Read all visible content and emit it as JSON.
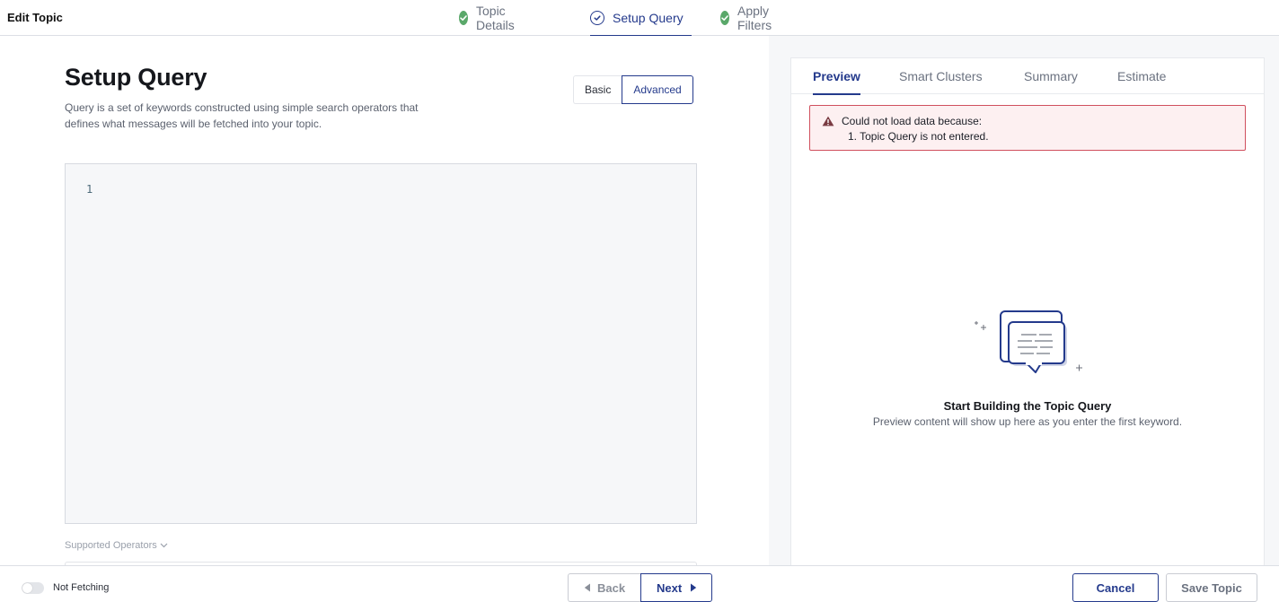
{
  "header": {
    "title": "Edit Topic",
    "steps": [
      {
        "label": "Topic Details",
        "state": "done"
      },
      {
        "label": "Setup Query",
        "state": "active"
      },
      {
        "label": "Apply Filters",
        "state": "done"
      }
    ]
  },
  "query": {
    "title": "Setup Query",
    "description": "Query is a set of keywords constructed using simple search operators that defines what messages will be fetched into your topic.",
    "mode_basic": "Basic",
    "mode_advanced": "Advanced",
    "selected_mode": "Advanced",
    "line_number": "1",
    "supported_operators_label": "Supported Operators"
  },
  "preview": {
    "tabs": [
      "Preview",
      "Smart Clusters",
      "Summary",
      "Estimate"
    ],
    "active_tab": "Preview",
    "error_title": "Could not load data because:",
    "error_item": "1. Topic Query is not entered.",
    "empty_title": "Start Building the Topic Query",
    "empty_desc": "Preview content will show up here as you enter the first keyword."
  },
  "footer": {
    "fetch_status": "Not Fetching",
    "back_label": "Back",
    "next_label": "Next",
    "cancel_label": "Cancel",
    "save_label": "Save Topic"
  },
  "colors": {
    "accent": "#243a8c",
    "success": "#5aa86a",
    "error_border": "#d0505e",
    "error_bg": "#fdf0f1"
  },
  "icons": {
    "step_done": "check-circle-icon",
    "step_active": "check-circle-outline-icon",
    "error": "warning-triangle-icon",
    "empty_state": "chat-bubbles-illustration",
    "back": "caret-left-icon",
    "next": "caret-right-icon",
    "dropdown": "chevron-down-icon"
  }
}
